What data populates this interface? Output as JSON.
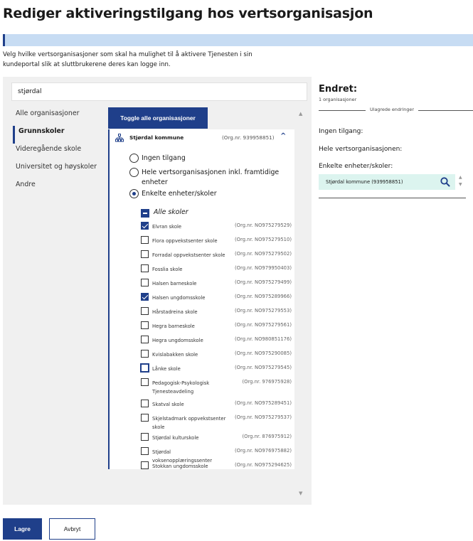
{
  "page": {
    "title": "Rediger aktiveringstilgang hos vertsorganisasjon",
    "description": "Velg hvilke vertsorganisasjoner som skal ha mulighet til å aktivere Tjenesten i sin kundeportal slik at sluttbrukerene deres kan logge inn."
  },
  "search": {
    "value": "stjørdal"
  },
  "nav": {
    "items": [
      {
        "label": "Alle organisasjoner"
      },
      {
        "label": "Grunnskoler",
        "active": true
      },
      {
        "label": "Videregående skole"
      },
      {
        "label": "Universitet og høyskoler"
      },
      {
        "label": "Andre"
      }
    ]
  },
  "toggle_all_label": "Toggle alle organisasjoner",
  "org": {
    "name": "Stjørdal kommune",
    "nr": "(Org.nr. 939958851)",
    "options": [
      {
        "label": "Ingen tilgang",
        "checked": false
      },
      {
        "label": "Hele vertsorganisasjonen inkl. framtidige enheter",
        "checked": false
      },
      {
        "label": "Enkelte enheter/skoler",
        "checked": true
      }
    ],
    "all_schools_label": "Alle skoler",
    "schools": [
      {
        "name": "Elvran skole",
        "nr": "(Org.nr. NO975279529)",
        "checked": true
      },
      {
        "name": "Flora oppvekstsenter skole",
        "nr": "(Org.nr. NO975279510)",
        "checked": false
      },
      {
        "name": "Forradal oppvekstsenter skole",
        "nr": "(Org.nr. NO975279502)",
        "checked": false
      },
      {
        "name": "Fosslia skole",
        "nr": "(Org.nr. NO979950403)",
        "checked": false
      },
      {
        "name": "Halsen barneskole",
        "nr": "(Org.nr. NO975279499)",
        "checked": false
      },
      {
        "name": "Halsen ungdomsskole",
        "nr": "(Org.nr. NO975289966)",
        "checked": true
      },
      {
        "name": "Hårstadreina skole",
        "nr": "(Org.nr. NO975279553)",
        "checked": false
      },
      {
        "name": "Hegra barneskole",
        "nr": "(Org.nr. NO975279561)",
        "checked": false
      },
      {
        "name": "Hegra ungdomsskole",
        "nr": "(Org.nr. NO980851176)",
        "checked": false
      },
      {
        "name": "Kvislabakken skole",
        "nr": "(Org.nr. NO975290085)",
        "checked": false
      },
      {
        "name": "Lånke skole",
        "nr": "(Org.nr. NO975279545)",
        "checked": false
      },
      {
        "name": "Pedagogisk-Psykologisk Tjenesteavdeling",
        "nr": "(Org.nr. 976975928)",
        "checked": false
      },
      {
        "name": "Skatval skole",
        "nr": "(Org.nr. NO975289451)",
        "checked": false
      },
      {
        "name": "Skjelstadmark oppvekstsenter skole",
        "nr": "(Org.nr. NO975279537)",
        "checked": false
      },
      {
        "name": "Stjørdal kulturskole",
        "nr": "(Org.nr. 876975912)",
        "checked": false
      },
      {
        "name": "Stjørdal voksenopplæringssenter",
        "nr": "(Org.nr. NO976975882)",
        "checked": false
      },
      {
        "name": "Stokkan ungdomsskole",
        "nr": "(Org.nr. NO975294625)",
        "checked": false
      }
    ]
  },
  "changes": {
    "title": "Endret:",
    "count": "1 organisasjoner",
    "divider": "Ulagrede endringer",
    "no_access_label": "Ingen tilgang:",
    "whole_org_label": "Hele vertsorganisasjonen:",
    "some_units_label": "Enkelte enheter/skoler:",
    "chip": "Stjørdal kommune (939958851)"
  },
  "buttons": {
    "save": "Lagre",
    "cancel": "Avbryt"
  },
  "colors": {
    "primary": "#1f3f8a",
    "info": "#c7dcf3",
    "chip": "#dcf4ef"
  }
}
